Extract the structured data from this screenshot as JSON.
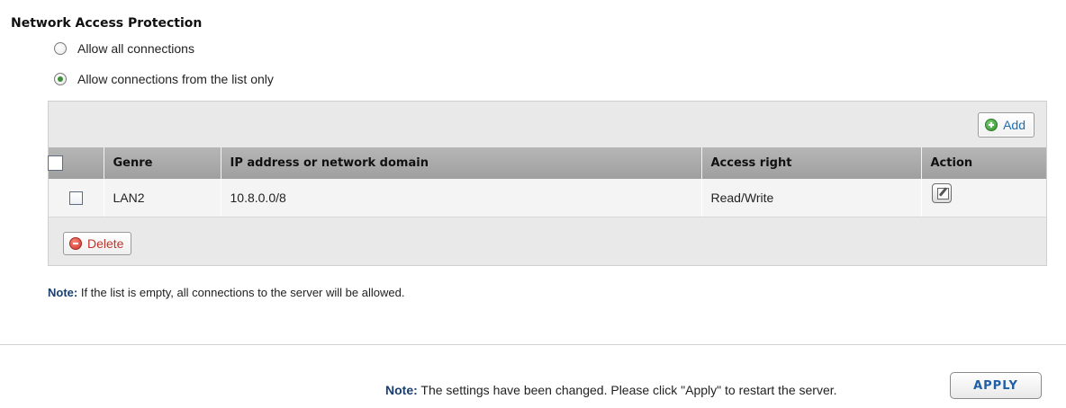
{
  "section": {
    "title": "Network Access Protection"
  },
  "radios": [
    {
      "label": "Allow all connections",
      "checked": false
    },
    {
      "label": "Allow connections from the list only",
      "checked": true
    }
  ],
  "toolbar": {
    "add_label": "Add",
    "delete_label": "Delete"
  },
  "table": {
    "columns": [
      "Genre",
      "IP address or network domain",
      "Access right",
      "Action"
    ],
    "rows": [
      {
        "genre": "LAN2",
        "ip": "10.8.0.0/8",
        "access": "Read/Write"
      }
    ]
  },
  "notes": {
    "note_label": "Note:",
    "list_empty_text": "If the list is empty, all connections to the server will be allowed.",
    "settings_changed_text": "The settings have been changed. Please click \"Apply\" to restart the server."
  },
  "apply_label": "APPLY",
  "colors": {
    "header_bg": "#a9a9a9",
    "note_label": "#1a3f6e",
    "add_icon": "#2f8f2c",
    "delete_icon": "#c9302c"
  },
  "icons": {
    "add": "plus-circle-icon",
    "delete": "minus-circle-icon",
    "edit": "edit-icon"
  }
}
